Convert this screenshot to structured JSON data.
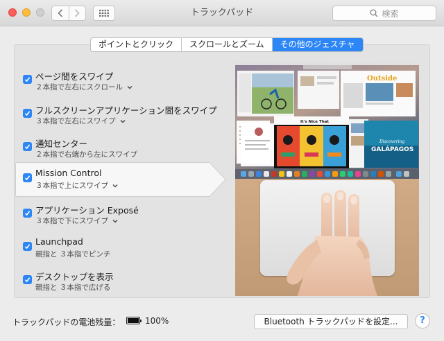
{
  "window": {
    "title": "トラックパッド",
    "search_placeholder": "検索"
  },
  "tabs": [
    {
      "label": "ポイントとクリック",
      "active": false
    },
    {
      "label": "スクロールとズーム",
      "active": false
    },
    {
      "label": "その他のジェスチャ",
      "active": true
    }
  ],
  "gestures": [
    {
      "label": "ページ間をスワイプ",
      "sub": "２本指で左右にスクロール",
      "checked": true,
      "has_menu": true
    },
    {
      "label": "フルスクリーンアプリケーション間をスワイプ",
      "sub": "３本指で左右にスワイプ",
      "checked": true,
      "has_menu": true
    },
    {
      "label": "通知センター",
      "sub": "２本指で右端から左にスワイプ",
      "checked": true,
      "has_menu": false
    },
    {
      "label": "Mission Control",
      "sub": "３本指で上にスワイプ",
      "checked": true,
      "has_menu": true,
      "selected": true
    },
    {
      "label": "アプリケーション Exposé",
      "sub": "３本指で下にスワイプ",
      "checked": true,
      "has_menu": true
    },
    {
      "label": "Launchpad",
      "sub": "親指と ３本指でピンチ",
      "checked": true,
      "has_menu": false
    },
    {
      "label": "デスクトップを表示",
      "sub": "親指と ３本指で広げる",
      "checked": true,
      "has_menu": false
    }
  ],
  "preview": {
    "window_texts": {
      "outside": "Outside",
      "poster": "It's Nice That",
      "discovering": "Discovering",
      "galapagos": "GALÁPAGOS"
    }
  },
  "battery": {
    "label": "トラックパッドの電池残量：",
    "percent_text": "100%",
    "level": 1.0
  },
  "bluetooth_button": "Bluetooth トラックパッドを設定...",
  "help_label": "?",
  "colors": {
    "accent": "#2d86f5",
    "close": "#fc605c",
    "minimize": "#fdbc40"
  }
}
